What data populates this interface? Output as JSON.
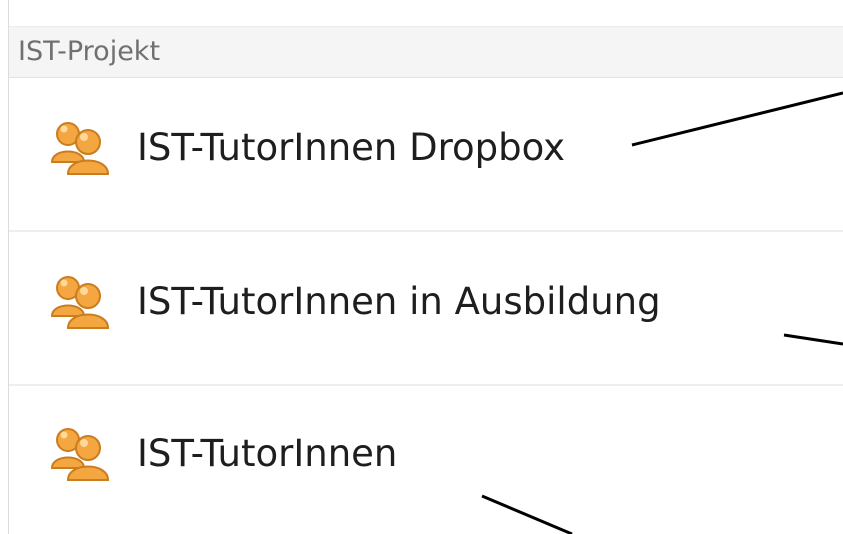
{
  "section": {
    "title": "IST-Projekt",
    "items": [
      {
        "label": "IST-TutorInnen Dropbox",
        "icon": "user-group-icon"
      },
      {
        "label": "IST-TutorInnen in Ausbildung",
        "icon": "user-group-icon"
      },
      {
        "label": "IST-TutorInnen",
        "icon": "user-group-icon"
      }
    ]
  },
  "colors": {
    "icon_fill": "#f4a640",
    "icon_outline": "#c97d1f",
    "header_background": "#f5f5f5",
    "callout_line": "#000000"
  }
}
